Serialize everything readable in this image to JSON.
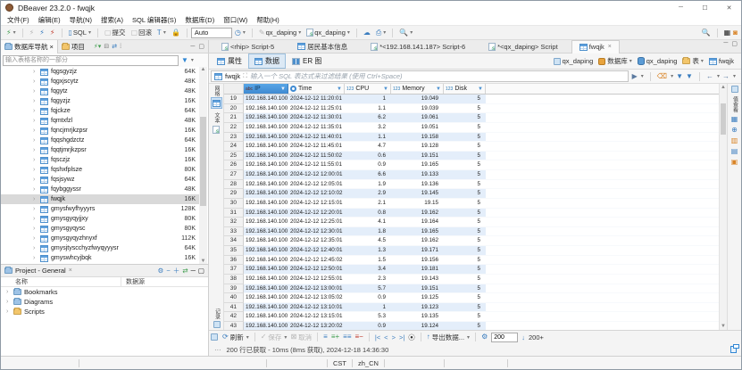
{
  "window": {
    "title": "DBeaver 23.2.0 - fwqjk"
  },
  "menu": {
    "items": [
      "文件(F)",
      "编辑(E)",
      "导航(N)",
      "搜索(A)",
      "SQL 编辑器(S)",
      "数据库(D)",
      "窗口(W)",
      "帮助(H)"
    ]
  },
  "toolbar": {
    "sql_label": "SQL",
    "commit_label": "提交",
    "rollback_label": "回滚",
    "auto_value": "Auto",
    "connection": "qx_daping",
    "database": "qx_daping"
  },
  "nav_panel": {
    "tab_navigator": "数据库导航",
    "tab_project": "项目",
    "filter_placeholder": "输入表格名称的一部分",
    "items": [
      {
        "name": "fqgsgyzjz",
        "size": "64K"
      },
      {
        "name": "fqgxjscytz",
        "size": "48K"
      },
      {
        "name": "fqgytz",
        "size": "48K"
      },
      {
        "name": "fqgyzjz",
        "size": "16K"
      },
      {
        "name": "fqjckze",
        "size": "64K"
      },
      {
        "name": "fqmtxfzl",
        "size": "48K"
      },
      {
        "name": "fqncjmrjkzpsr",
        "size": "16K"
      },
      {
        "name": "fqqshgdzctz",
        "size": "64K"
      },
      {
        "name": "fqqtjmrjkzpsr",
        "size": "16K"
      },
      {
        "name": "fqsczjz",
        "size": "16K"
      },
      {
        "name": "fqshxfplsze",
        "size": "80K"
      },
      {
        "name": "fqsjsywz",
        "size": "64K"
      },
      {
        "name": "fqybggyssr",
        "size": "48K"
      },
      {
        "name": "fwqjk",
        "size": "16K",
        "selected": true
      },
      {
        "name": "gmysfwyfhyyyrs",
        "size": "128K"
      },
      {
        "name": "gmysgyqyjjxy",
        "size": "80K"
      },
      {
        "name": "gmysgyqysc",
        "size": "80K"
      },
      {
        "name": "gmysgyqyzhnyxf",
        "size": "112K"
      },
      {
        "name": "gmysjtyscchyzfwyqyyysr",
        "size": "64K"
      },
      {
        "name": "gmyswhcyjbqk",
        "size": "16K"
      }
    ]
  },
  "project_panel": {
    "title": "Project - General",
    "col_name": "名称",
    "col_source": "数据源",
    "items": [
      {
        "label": "Bookmarks",
        "type": "blue-f"
      },
      {
        "label": "Diagrams",
        "type": "blue-f"
      },
      {
        "label": "Scripts",
        "type": ""
      }
    ]
  },
  "editor_tabs": [
    {
      "label": "<rhip> Script-5",
      "type": "sql"
    },
    {
      "label": "居民基本信息",
      "type": "table"
    },
    {
      "label": "*<192.168.141.187> Script-6",
      "type": "sql"
    },
    {
      "label": "*<qx_daping> Script",
      "type": "sql"
    },
    {
      "label": "fwqjk",
      "type": "table",
      "active": true,
      "close": "×"
    }
  ],
  "main": {
    "tabs": [
      {
        "label": "属性",
        "icon": "table"
      },
      {
        "label": "数据",
        "icon": "table",
        "active": true
      },
      {
        "label": "ER 图",
        "icon": "er"
      }
    ],
    "breadcrumb": [
      {
        "label": "qx_daping",
        "type": "conn"
      },
      {
        "label": "数据库",
        "type": "dbo",
        "caret": true
      },
      {
        "label": "qx_daping",
        "type": "db"
      },
      {
        "label": "表",
        "type": "folder",
        "caret": true
      },
      {
        "label": "fwqjk",
        "type": "table"
      }
    ],
    "filter": {
      "table": "fwqjk",
      "placeholder": "输入一个 SQL 表达式来过滤结果 (使用 Ctrl+Space)"
    },
    "presentation": {
      "grid": "网格",
      "text": "文本",
      "record": "记录",
      "value_panel": "值查看"
    },
    "grid": {
      "columns": [
        {
          "label": "IP",
          "type": "abc",
          "selected": true
        },
        {
          "label": "Time",
          "type": "time"
        },
        {
          "label": "CPU",
          "type": "123"
        },
        {
          "label": "Memory",
          "type": "123"
        },
        {
          "label": "Disk",
          "type": "123"
        }
      ],
      "rows": [
        [
          "19",
          "192.168.140.100",
          "2024-12-12 11:20:01",
          "1",
          "19.049",
          "5"
        ],
        [
          "20",
          "192.168.140.100",
          "2024-12-12 11:25:01",
          "1.1",
          "19.039",
          "5"
        ],
        [
          "21",
          "192.168.140.100",
          "2024-12-12 11:30:01",
          "6.2",
          "19.061",
          "5"
        ],
        [
          "22",
          "192.168.140.100",
          "2024-12-12 11:35:01",
          "3.2",
          "19.051",
          "5"
        ],
        [
          "23",
          "192.168.140.100",
          "2024-12-12 11:40:01",
          "1.1",
          "19.158",
          "5"
        ],
        [
          "24",
          "192.168.140.100",
          "2024-12-12 11:45:01",
          "4.7",
          "19.128",
          "5"
        ],
        [
          "25",
          "192.168.140.100",
          "2024-12-12 11:50:02",
          "0.6",
          "19.151",
          "5"
        ],
        [
          "26",
          "192.168.140.100",
          "2024-12-12 11:55:01",
          "0.9",
          "19.165",
          "5"
        ],
        [
          "27",
          "192.168.140.100",
          "2024-12-12 12:00:01",
          "6.6",
          "19.133",
          "5"
        ],
        [
          "28",
          "192.168.140.100",
          "2024-12-12 12:05:01",
          "1.9",
          "19.136",
          "5"
        ],
        [
          "29",
          "192.168.140.100",
          "2024-12-12 12:10:02",
          "2.9",
          "19.145",
          "5"
        ],
        [
          "30",
          "192.168.140.100",
          "2024-12-12 12:15:01",
          "2.1",
          "19.15",
          "5"
        ],
        [
          "31",
          "192.168.140.100",
          "2024-12-12 12:20:01",
          "0.8",
          "19.162",
          "5"
        ],
        [
          "32",
          "192.168.140.100",
          "2024-12-12 12:25:01",
          "4.1",
          "19.164",
          "5"
        ],
        [
          "33",
          "192.168.140.100",
          "2024-12-12 12:30:01",
          "1.8",
          "19.165",
          "5"
        ],
        [
          "34",
          "192.168.140.100",
          "2024-12-12 12:35:01",
          "4.5",
          "19.162",
          "5"
        ],
        [
          "35",
          "192.168.140.100",
          "2024-12-12 12:40:01",
          "1.3",
          "19.171",
          "5"
        ],
        [
          "36",
          "192.168.140.100",
          "2024-12-12 12:45:02",
          "1.5",
          "19.156",
          "5"
        ],
        [
          "37",
          "192.168.140.100",
          "2024-12-12 12:50:01",
          "3.4",
          "19.181",
          "5"
        ],
        [
          "38",
          "192.168.140.100",
          "2024-12-12 12:55:01",
          "2.3",
          "19.143",
          "5"
        ],
        [
          "39",
          "192.168.140.100",
          "2024-12-12 13:00:01",
          "5.7",
          "19.151",
          "5"
        ],
        [
          "40",
          "192.168.140.100",
          "2024-12-12 13:05:02",
          "0.9",
          "19.125",
          "5"
        ],
        [
          "41",
          "192.168.140.100",
          "2024-12-12 13:10:01",
          "1",
          "19.123",
          "5"
        ],
        [
          "42",
          "192.168.140.100",
          "2024-12-12 13:15:01",
          "5.3",
          "19.135",
          "5"
        ],
        [
          "43",
          "192.168.140.100",
          "2024-12-12 13:20:02",
          "0.9",
          "19.124",
          "5"
        ]
      ]
    },
    "bottom_toolbar": {
      "refresh": "刷新",
      "save": "保存",
      "cancel": "取消",
      "export": "导出数据...",
      "fetch_size": "200",
      "fetch_more": "200+"
    },
    "status_text": "200 行已获取 - 10ms (8ms 获取), 2024-12-18 14:36:30"
  },
  "statusbar": {
    "timezone": "CST",
    "locale": "zh_CN"
  }
}
